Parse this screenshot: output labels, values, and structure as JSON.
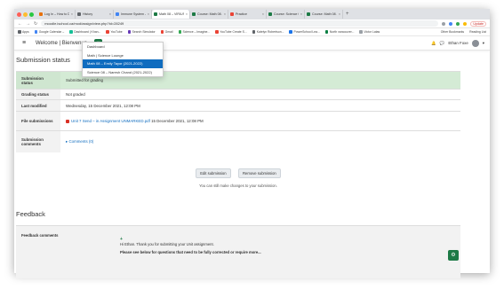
{
  "browser": {
    "tabs": [
      {
        "label": "Log In – How to Do Stuff –",
        "color": "#e8710a",
        "active": false
      },
      {
        "label": "History",
        "color": "#5f6368",
        "active": false
      },
      {
        "label": "Immune System – Google",
        "color": "#4285f4",
        "active": false
      },
      {
        "label": "Math 08 – VIRIUS IDA – Sub",
        "color": "#1d7a46",
        "active": true
      },
      {
        "label": "Course: Math 08 – Emily",
        "color": "#1d7a46",
        "active": false
      },
      {
        "label": "Practice",
        "color": "#ea4335",
        "active": false
      },
      {
        "label": "Course: Science 08 – Nar",
        "color": "#1d7a46",
        "active": false
      },
      {
        "label": "Course: Math 08 – Emily",
        "color": "#1d7a46",
        "active": false
      }
    ],
    "url": "moodle.ischool.ca/mod/assign/view.php?id=28249",
    "update_label": "Update",
    "bookmarks": [
      {
        "label": "Apps",
        "color": "#5f6368"
      },
      {
        "label": "Google Calendar –",
        "color": "#4285f4"
      },
      {
        "label": "Dashboard | Khan...",
        "color": "#14bf96"
      },
      {
        "label": "YouTube",
        "color": "#ea4335"
      },
      {
        "label": "Search Simulator",
        "color": "#673ab7"
      },
      {
        "label": "Gmail",
        "color": "#ea4335"
      },
      {
        "label": "Science – Imagine...",
        "color": "#34a853"
      },
      {
        "label": "YouTube Create S...",
        "color": "#ea4335"
      },
      {
        "label": "Katelyn Robertson...",
        "color": "#5f6368"
      },
      {
        "label": "PowerSchool Lea...",
        "color": "#1a73e8"
      },
      {
        "label": "North vancouver...",
        "color": "#0b8043"
      },
      {
        "label": "Victor Latas",
        "color": "#9aa0a6"
      }
    ],
    "bookmarks_right": [
      "Other Bookmarks",
      "Reading List"
    ]
  },
  "moodle": {
    "site_name": "Welcome | Bienvenue",
    "my_courses_label": "My Courses",
    "user_name": "Ethan Foxe",
    "dropdown": [
      {
        "label": "Dashboard",
        "selected": false
      },
      {
        "label": "Math | Science Lounge",
        "selected": false
      },
      {
        "label": "Math 08 – Emily Tayor (2021-2022)",
        "selected": true
      },
      {
        "label": "Science 08 – Naresh Chand (2021-2022)",
        "selected": false
      }
    ]
  },
  "submission": {
    "heading": "Submission status",
    "rows": [
      {
        "label": "Submission status",
        "value": "Submitted for grading",
        "highlight": true
      },
      {
        "label": "Grading status",
        "value": "Not graded",
        "highlight": false
      },
      {
        "label": "Last modified",
        "value": "Wednesday, 15 December 2021, 12:08 PM",
        "highlight": false
      },
      {
        "label": "File submissions",
        "file": "Unit 7 Send – in Assignment UNMARKED.pdf",
        "file_date": "15 December 2021, 12:08 PM",
        "highlight": false
      },
      {
        "label": "Submission comments",
        "value": "Comments (0)",
        "highlight": false
      }
    ],
    "edit_label": "Edit submission",
    "remove_label": "Remove submission",
    "hint": "You can still make changes to your submission."
  },
  "feedback": {
    "heading": "Feedback",
    "label": "Feedback comments",
    "line1": "Hi Ethan. Thank you for submitting your Unit assignment.",
    "line2": "Please see below for questions that need to be fully corrected or require more..."
  },
  "colors": {
    "accent": "#1d7a46",
    "link": "#0f6cbf",
    "highlight": "#d4ebd5"
  }
}
